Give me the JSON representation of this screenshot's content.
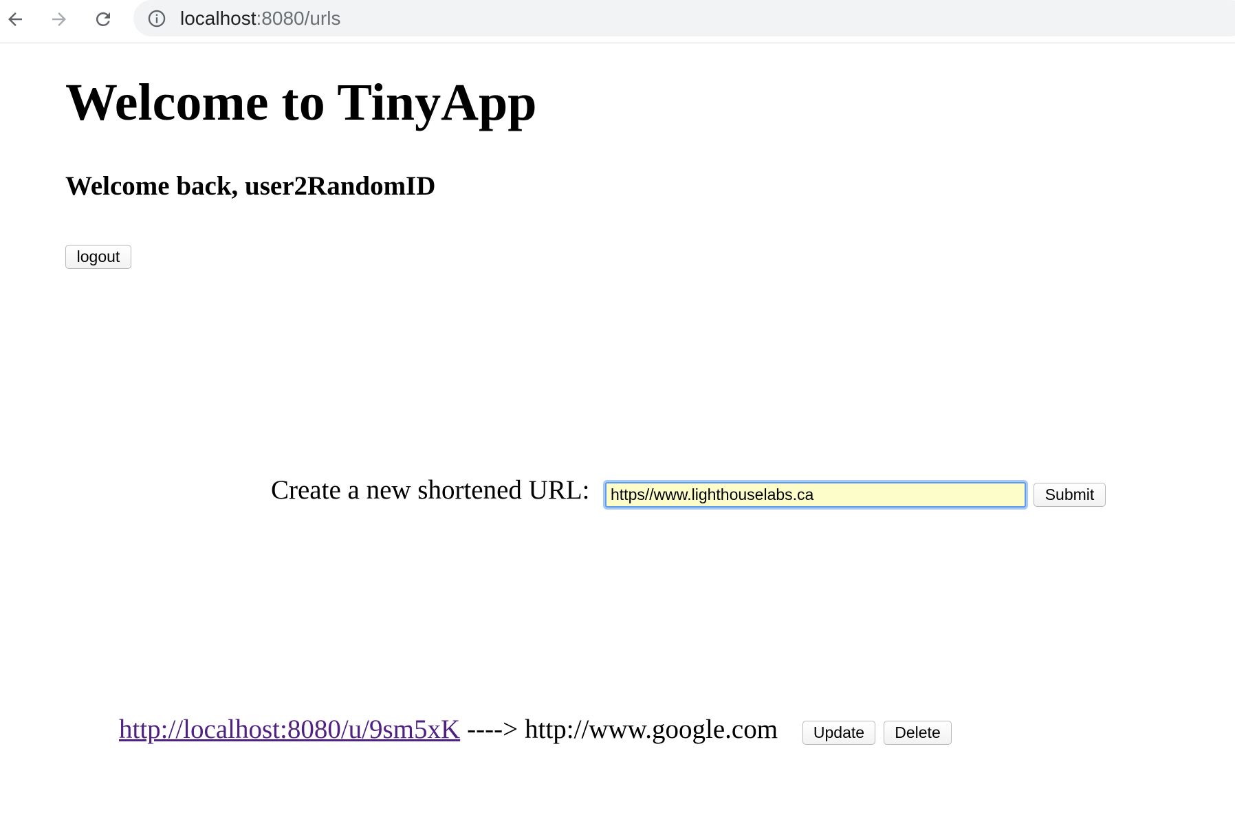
{
  "browser": {
    "url_host": "localhost",
    "url_rest": ":8080/urls",
    "icons": [
      "back-arrow-icon",
      "forward-arrow-icon",
      "reload-icon",
      "info-icon"
    ]
  },
  "page": {
    "title": "Welcome to TinyApp",
    "welcome_text": "Welcome back, user2RandomID",
    "logout_label": "logout"
  },
  "create_form": {
    "label": "Create a new shortened URL:",
    "input_value": "https//www.lighthouselabs.ca",
    "submit_label": "Submit"
  },
  "urls": [
    {
      "short_url": "http://localhost:8080/u/9sm5xK",
      "arrow": "---->",
      "long_url": "http://www.google.com",
      "update_label": "Update",
      "delete_label": "Delete"
    }
  ],
  "colors": {
    "link_visited": "#4f2182",
    "input_autofill_bg": "#fcfdc8",
    "focus_ring": "#5b9bf0"
  }
}
